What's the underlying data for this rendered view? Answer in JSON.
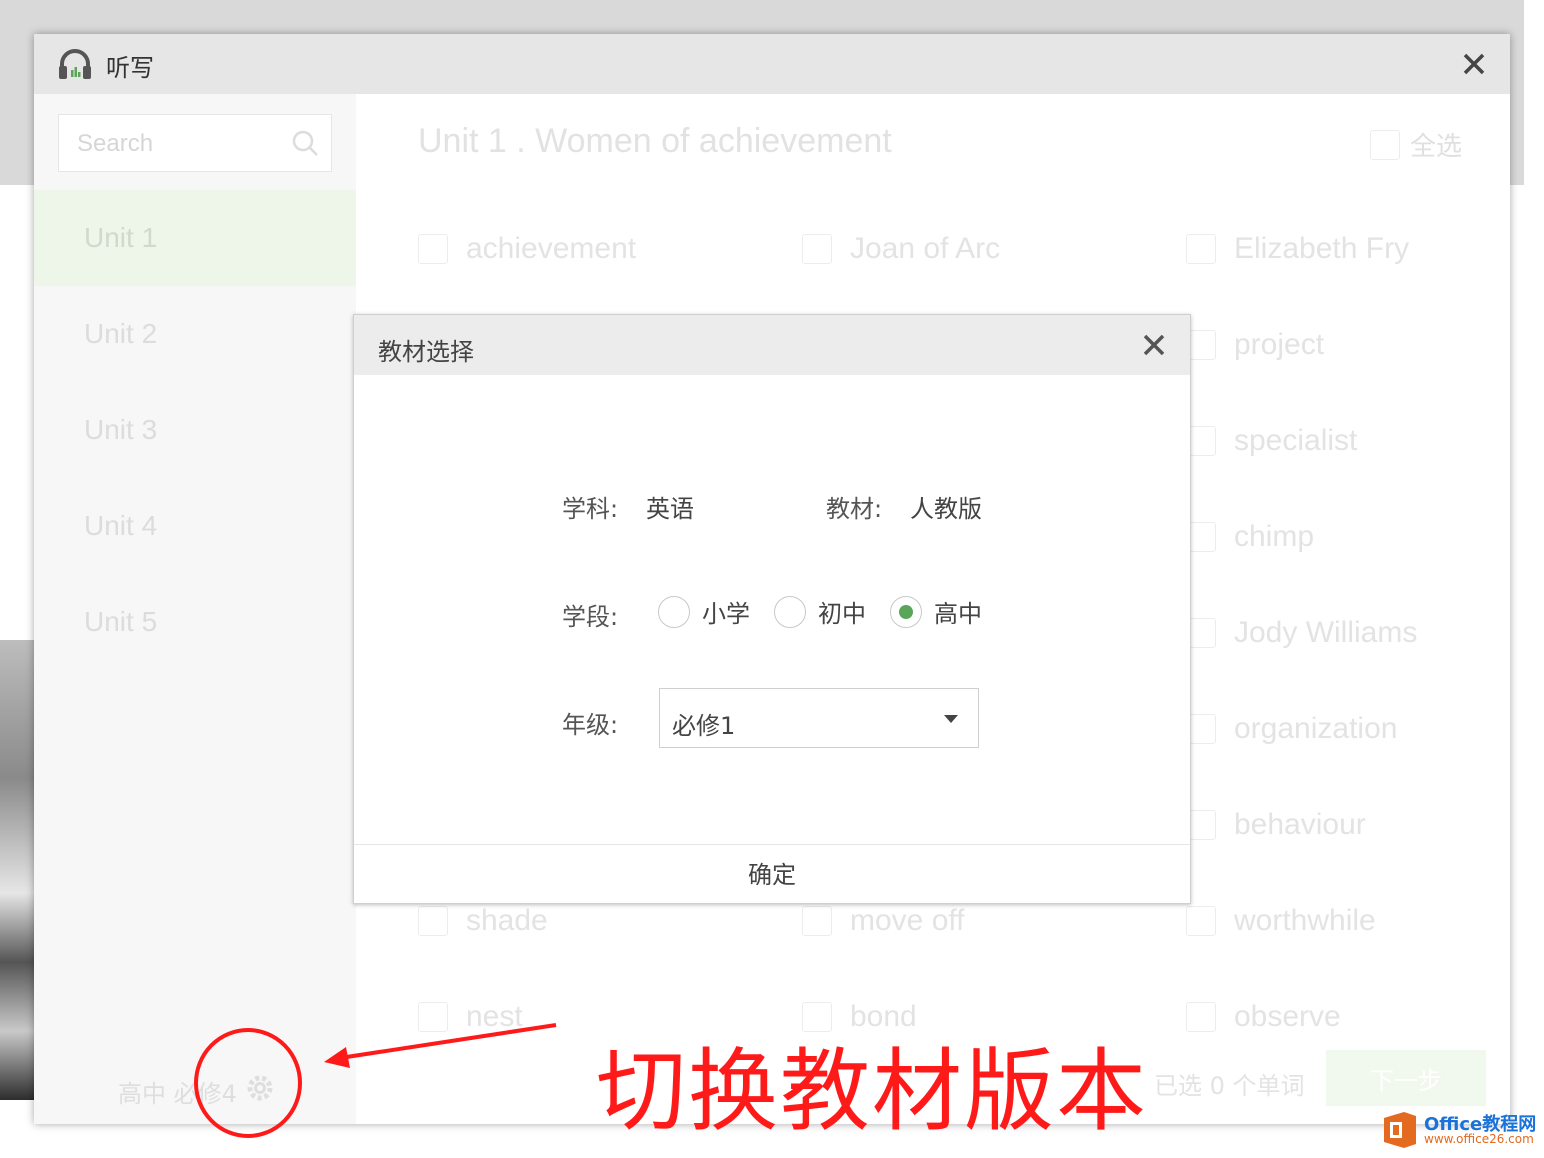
{
  "window": {
    "title": "听写"
  },
  "sidebar": {
    "search_placeholder": "Search",
    "units": [
      {
        "label": "Unit 1",
        "active": true
      },
      {
        "label": "Unit 2",
        "active": false
      },
      {
        "label": "Unit 3",
        "active": false
      },
      {
        "label": "Unit 4",
        "active": false
      },
      {
        "label": "Unit 5",
        "active": false
      }
    ],
    "footer_textbook": "高中 必修4"
  },
  "content": {
    "unit_title": "Unit 1 . Women of achievement",
    "select_all_label": "全选",
    "words": [
      "achievement",
      "Joan of Arc",
      "Elizabeth Fry",
      "project",
      "specialist",
      "chimp",
      "Jody Williams",
      "organization",
      "behaviour",
      "shade",
      "move off",
      "worthwhile",
      "nest",
      "bond",
      "observe"
    ],
    "selected_count": "已选 0 个单词",
    "next_label": "下一步"
  },
  "dialog": {
    "title": "教材选择",
    "subject_label": "学科:",
    "subject_value": "英语",
    "textbook_label": "教材:",
    "textbook_value": "人教版",
    "stage_label": "学段:",
    "stages": [
      {
        "label": "小学",
        "selected": false
      },
      {
        "label": "初中",
        "selected": false
      },
      {
        "label": "高中",
        "selected": true
      }
    ],
    "grade_label": "年级:",
    "grade_value": "必修1",
    "ok_label": "确定"
  },
  "annotation": {
    "text": "切换教材版本",
    "color": "#ff1a1a"
  },
  "watermark": {
    "brand": "Office教程网",
    "url": "www.office26.com"
  },
  "colors": {
    "accent_green": "#5aa55a",
    "title_bar": "#e6e6e6"
  }
}
